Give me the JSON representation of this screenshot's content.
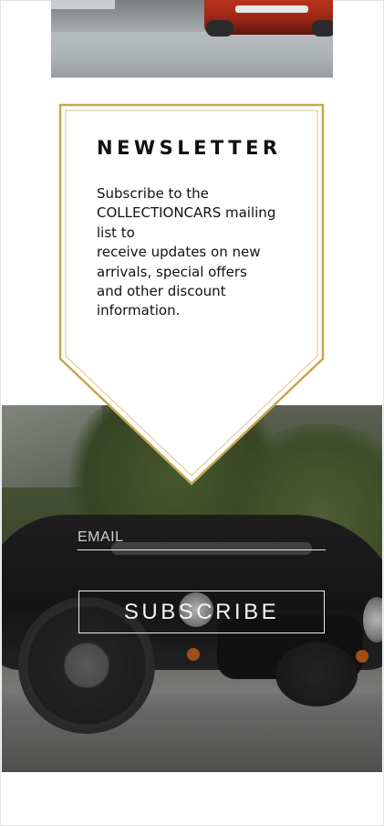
{
  "newsletter": {
    "title": "NEWSLETTER",
    "body_lines": [
      "Subscribe to the",
      "COLLECTIONCARS mailing",
      "list to",
      "receive updates on new",
      "arrivals, special offers",
      "and other discount",
      "information."
    ]
  },
  "form": {
    "email_placeholder": "EMAIL",
    "email_value": "",
    "subscribe_label": "SUBSCRIBE"
  },
  "colors": {
    "accent_gold": "#c9a74a",
    "text": "#111111",
    "background": "#ffffff"
  }
}
